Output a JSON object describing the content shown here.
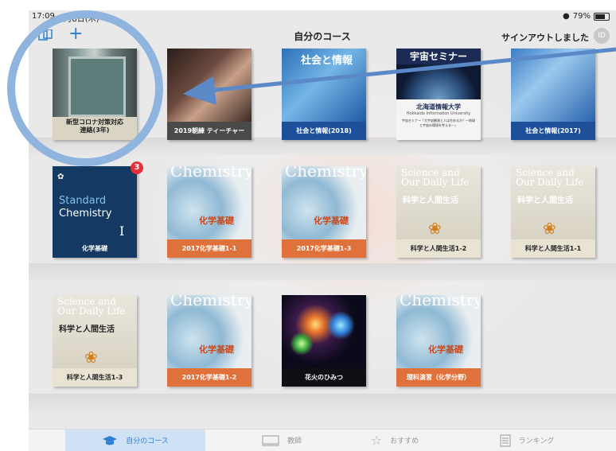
{
  "status": {
    "time": "17:09",
    "date": "5月8日(木)",
    "battery": "79%"
  },
  "navbar": {
    "title": "自分のコース",
    "plus": "+",
    "signout": "サインアウトしました",
    "avatar": "ID"
  },
  "books": [
    {
      "label": "新型コロナ対策対応\n連絡(3年)",
      "line1": "新型コロナ対策対応",
      "line2": "連絡(3年)"
    },
    {
      "label": "2019朝練 ティーチャー"
    },
    {
      "label": "社会と情報(2018)",
      "cover_title": "社会と情報"
    },
    {
      "label": "",
      "cover_title": "宇宙セミナー",
      "sub": "北海道情報大学",
      "sub2": "Hokkaido Information University",
      "desc1": "宇宙セミナー「大宇宙観測と人は住めるか？―地球と宇宙の環境を考える―」"
    },
    {
      "label": "社会と情報(2017)"
    },
    {
      "label": "化学基礎",
      "cover_title": "Standard",
      "cover_title2": "Chemistry",
      "roman": "I",
      "badge": "3"
    },
    {
      "label": "2017化学基礎1-1",
      "cover_title": "Chemistry",
      "jp": "化学基礎"
    },
    {
      "label": "2017化学基礎1-3",
      "cover_title": "Chemistry",
      "jp": "化学基礎"
    },
    {
      "label": "科学と人間生活1-2",
      "cover_title": "Science and",
      "cover_title2": "Our Daily Life",
      "jp": "科学と人間生活"
    },
    {
      "label": "科学と人間生活1-1",
      "cover_title": "Science and",
      "cover_title2": "Our Daily Life",
      "jp": "科学と人間生活"
    },
    {
      "label": "科学と人間生活1-3",
      "cover_title": "Science and",
      "cover_title2": "Our Daily Life",
      "jp": "科学と人間生活"
    },
    {
      "label": "2017化学基礎1-2",
      "cover_title": "Chemistry",
      "jp": "化学基礎"
    },
    {
      "label": "花火のひみつ"
    },
    {
      "label": "理科演習（化学分野）",
      "cover_title": "Chemistry",
      "jp": "化学基礎"
    }
  ],
  "tabs": [
    {
      "label": "自分のコース",
      "icon": "graduation-cap-icon"
    },
    {
      "label": "教師",
      "icon": "monitor-icon"
    },
    {
      "label": "おすすめ",
      "icon": "star-icon"
    },
    {
      "label": "ランキング",
      "icon": "list-icon"
    }
  ],
  "colors": {
    "accent": "#2d7fd3",
    "annotation": "#8fb5df",
    "orange_label": "#e0713a",
    "navy": "#143a63",
    "badge": "#e5303a"
  }
}
